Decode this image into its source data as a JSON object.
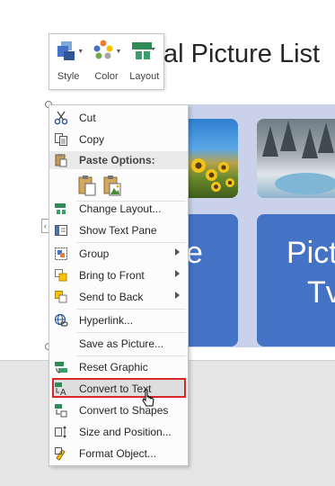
{
  "slide": {
    "title": "al Picture List",
    "box1_text": "e",
    "box2_text_line1": "Pict",
    "box2_text_line2": "Tv"
  },
  "mini_toolbar": {
    "style_label": "Style",
    "color_label": "Color",
    "layout_label": "Layout"
  },
  "context_menu": {
    "cut": "Cut",
    "copy": "Copy",
    "paste_options": "Paste Options:",
    "change_layout": "Change Layout...",
    "show_text_pane": "Show Text Pane",
    "group": "Group",
    "bring_to_front": "Bring to Front",
    "send_to_back": "Send to Back",
    "hyperlink": "Hyperlink...",
    "save_as_picture": "Save as Picture...",
    "reset_graphic": "Reset Graphic",
    "convert_to_text": "Convert to Text",
    "convert_to_shapes": "Convert to Shapes",
    "size_and_position": "Size and Position...",
    "format_object": "Format Object..."
  },
  "colors": {
    "smartart_blue": "#4472c4",
    "highlight_border": "#d9262b"
  }
}
